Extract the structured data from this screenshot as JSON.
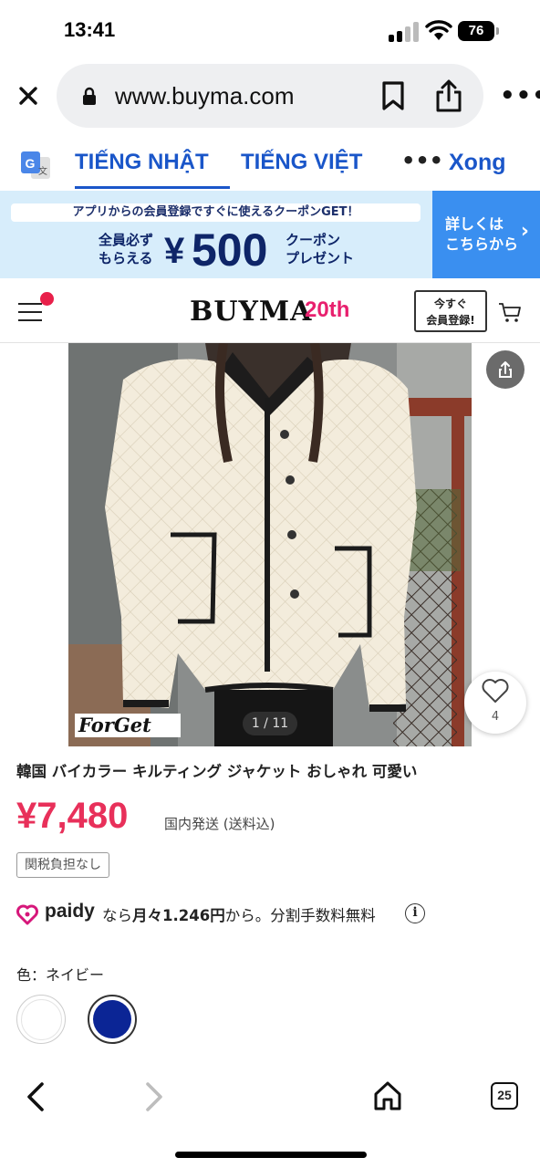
{
  "status_bar": {
    "time": "13:41",
    "battery": "76"
  },
  "browser": {
    "url": "www.buyma.com",
    "tabs_count": "25"
  },
  "translate_bar": {
    "lang_from": "TIẾNG NHẬT",
    "lang_to": "TIẾNG VIỆT",
    "more": "•••",
    "done": "Xong"
  },
  "banner": {
    "top_text": "アプリからの会員登録ですぐに使えるクーポンGET！",
    "left_line1": "全員必ず",
    "left_line2": "もらえる",
    "currency": "¥",
    "amount": "500",
    "right_line1": "クーポン",
    "right_line2": "プレゼント",
    "cta_line1": "詳しくは",
    "cta_line2": "こちらから"
  },
  "site_header": {
    "logo": "BUYMA",
    "logo_badge": "20th",
    "register_line1": "今すぐ",
    "register_line2": "会員登録!"
  },
  "product": {
    "image_counter": "1 / 11",
    "watermark": "ForGet",
    "like_count": "4",
    "title": "韓国 バイカラー キルティング ジャケット おしゃれ 可愛い",
    "price": "¥7,480",
    "shipping": "国内発送 (送料込)",
    "tax_badge": "関税負担なし",
    "paidy_logo": "paidy",
    "paidy_pre": "なら",
    "paidy_bold": "月々1.246円",
    "paidy_post": "から。分割手数料無料",
    "color_label": "色：ネイビー",
    "colors": [
      {
        "name": "white",
        "hex": "#ffffff"
      },
      {
        "name": "navy",
        "hex": "#0b2595"
      }
    ]
  },
  "theme": {
    "accent": "#1a56c9",
    "price": "#e8305a",
    "brand_pink": "#e8206e",
    "banner_bg": "#d7edfb",
    "banner_cta": "#3a8ff0"
  }
}
